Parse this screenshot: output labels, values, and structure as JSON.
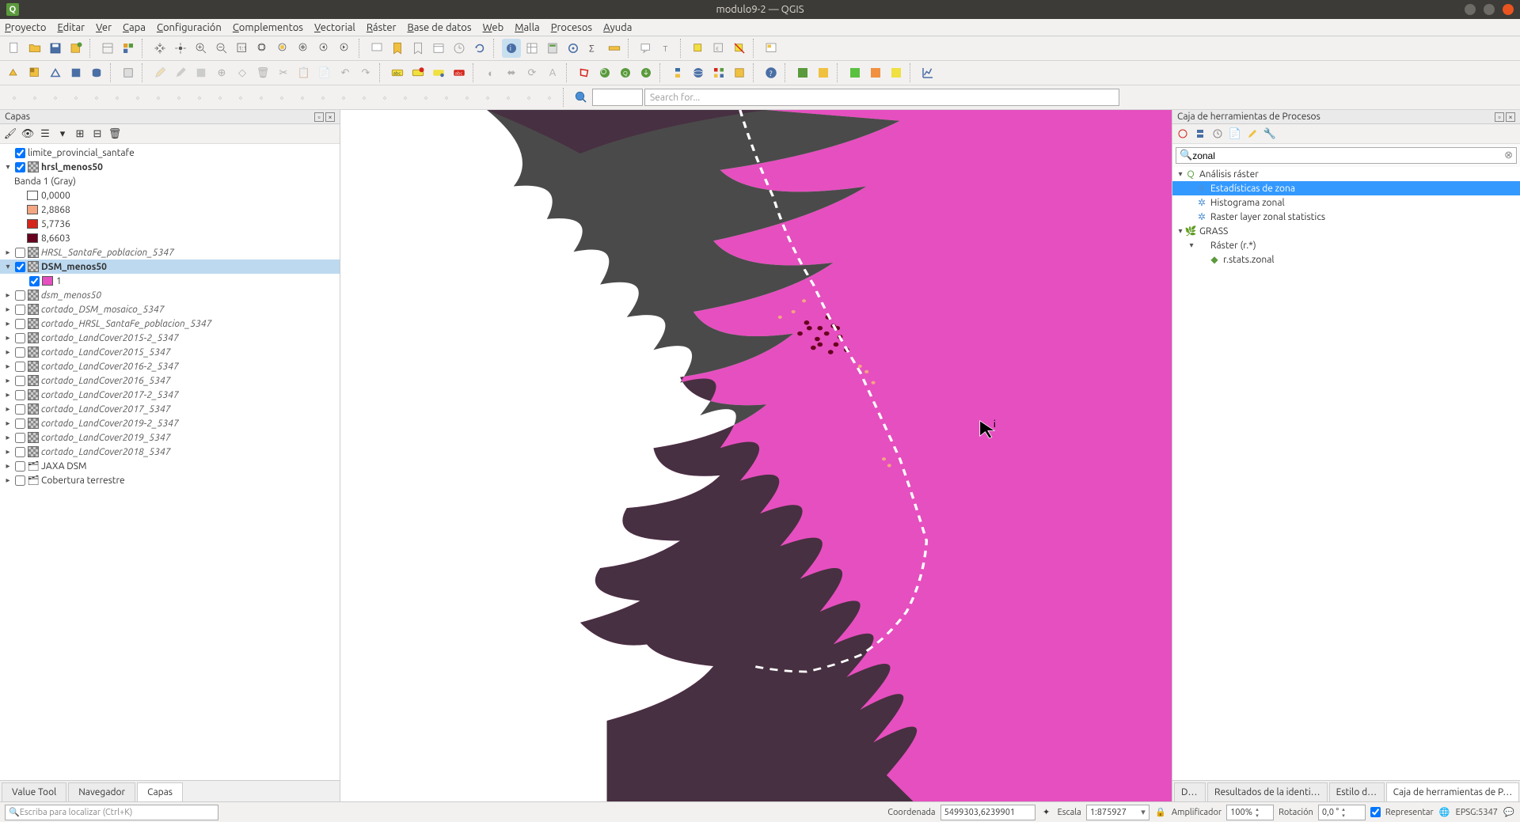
{
  "window": {
    "title": "modulo9-2 — QGIS"
  },
  "menu": [
    "Proyecto",
    "Editar",
    "Ver",
    "Capa",
    "Configuración",
    "Complementos",
    "Vectorial",
    "Ráster",
    "Base de datos",
    "Web",
    "Malla",
    "Procesos",
    "Ayuda"
  ],
  "search_placeholder": "Search for...",
  "panels": {
    "layers_title": "Capas",
    "processing_title": "Caja de herramientas de Procesos"
  },
  "layers": {
    "items": [
      {
        "type": "layer",
        "name": "limite_provincial_santafe",
        "checked": true,
        "expand": null,
        "icon": "none",
        "bold": false,
        "italic": false,
        "indent": 0
      },
      {
        "type": "layer",
        "name": "hrsl_menos50",
        "checked": true,
        "expand": "open",
        "icon": "raster",
        "bold": true,
        "italic": false,
        "indent": 0
      },
      {
        "type": "band",
        "name": "Banda 1 (Gray)",
        "indent": 1
      },
      {
        "type": "class",
        "name": "0,0000",
        "color": "#ffffff",
        "indent": 2
      },
      {
        "type": "class",
        "name": "2,8868",
        "color": "#f4a582",
        "indent": 2
      },
      {
        "type": "class",
        "name": "5,7736",
        "color": "#d6261b",
        "indent": 2
      },
      {
        "type": "class",
        "name": "8,6603",
        "color": "#67001f",
        "indent": 2
      },
      {
        "type": "layer",
        "name": "HRSL_SantaFe_poblacion_5347",
        "checked": false,
        "expand": "closed",
        "icon": "raster",
        "bold": false,
        "italic": true,
        "indent": 0
      },
      {
        "type": "layer",
        "name": "DSM_menos50",
        "checked": true,
        "expand": "open",
        "icon": "raster",
        "bold": true,
        "italic": false,
        "indent": 0,
        "selected": true
      },
      {
        "type": "class",
        "name": "1",
        "color": "#e64fbf",
        "checked": true,
        "indent": 2
      },
      {
        "type": "layer",
        "name": "dsm_menos50",
        "checked": false,
        "expand": "closed",
        "icon": "raster",
        "bold": false,
        "italic": true,
        "indent": 0
      },
      {
        "type": "layer",
        "name": "cortado_DSM_mosaico_5347",
        "checked": false,
        "expand": "closed",
        "icon": "raster",
        "bold": false,
        "italic": true,
        "indent": 0
      },
      {
        "type": "layer",
        "name": "cortado_HRSL_SantaFe_poblacion_5347",
        "checked": false,
        "expand": "closed",
        "icon": "raster",
        "bold": false,
        "italic": true,
        "indent": 0
      },
      {
        "type": "layer",
        "name": "cortado_LandCover2015-2_5347",
        "checked": false,
        "expand": "closed",
        "icon": "raster",
        "bold": false,
        "italic": true,
        "indent": 0
      },
      {
        "type": "layer",
        "name": "cortado_LandCover2015_5347",
        "checked": false,
        "expand": "closed",
        "icon": "raster",
        "bold": false,
        "italic": true,
        "indent": 0
      },
      {
        "type": "layer",
        "name": "cortado_LandCover2016-2_5347",
        "checked": false,
        "expand": "closed",
        "icon": "raster",
        "bold": false,
        "italic": true,
        "indent": 0
      },
      {
        "type": "layer",
        "name": "cortado_LandCover2016_5347",
        "checked": false,
        "expand": "closed",
        "icon": "raster",
        "bold": false,
        "italic": true,
        "indent": 0
      },
      {
        "type": "layer",
        "name": "cortado_LandCover2017-2_5347",
        "checked": false,
        "expand": "closed",
        "icon": "raster",
        "bold": false,
        "italic": true,
        "indent": 0
      },
      {
        "type": "layer",
        "name": "cortado_LandCover2017_5347",
        "checked": false,
        "expand": "closed",
        "icon": "raster",
        "bold": false,
        "italic": true,
        "indent": 0
      },
      {
        "type": "layer",
        "name": "cortado_LandCover2019-2_5347",
        "checked": false,
        "expand": "closed",
        "icon": "raster",
        "bold": false,
        "italic": true,
        "indent": 0
      },
      {
        "type": "layer",
        "name": "cortado_LandCover2019_5347",
        "checked": false,
        "expand": "closed",
        "icon": "raster",
        "bold": false,
        "italic": true,
        "indent": 0
      },
      {
        "type": "layer",
        "name": "cortado_LandCover2018_5347",
        "checked": false,
        "expand": "closed",
        "icon": "raster",
        "bold": false,
        "italic": true,
        "indent": 0
      },
      {
        "type": "group",
        "name": "JAXA DSM",
        "checked": false,
        "expand": "closed",
        "icon": "group",
        "indent": 0
      },
      {
        "type": "group",
        "name": "Cobertura terrestre",
        "checked": false,
        "expand": "closed",
        "icon": "group",
        "indent": 0
      }
    ]
  },
  "left_tabs": [
    "Value Tool",
    "Navegador",
    "Capas"
  ],
  "left_tab_active": 2,
  "processing": {
    "search_value": "zonal",
    "tree": [
      {
        "label": "Análisis ráster",
        "icon": "qgis",
        "level": 0,
        "expand": "open"
      },
      {
        "label": "Estadísticas de zona",
        "icon": "alg",
        "level": 1,
        "selected": true
      },
      {
        "label": "Histograma zonal",
        "icon": "alg",
        "level": 1
      },
      {
        "label": "Raster layer zonal statistics",
        "icon": "alg",
        "level": 1
      },
      {
        "label": "GRASS",
        "icon": "grass",
        "level": 0,
        "expand": "open"
      },
      {
        "label": "Ráster (r.*)",
        "icon": "folder",
        "level": 1,
        "expand": "open"
      },
      {
        "label": "r.stats.zonal",
        "icon": "grass-alg",
        "level": 2
      }
    ]
  },
  "right_tabs": [
    "Da…",
    "Resultados de la identi…",
    "Estilo d…",
    "Caja de herramientas de P…"
  ],
  "right_tab_active": 3,
  "status": {
    "locator_placeholder": "Escriba para localizar (Ctrl+K)",
    "coord_label": "Coordenada",
    "coord_value": "5499303,6239901",
    "scale_label": "Escala",
    "scale_value": "1:875927",
    "mag_label": "Amplificador",
    "mag_value": "100%",
    "rot_label": "Rotación",
    "rot_value": "0,0 °",
    "render_label": "Representar",
    "crs": "EPSG:5347"
  }
}
